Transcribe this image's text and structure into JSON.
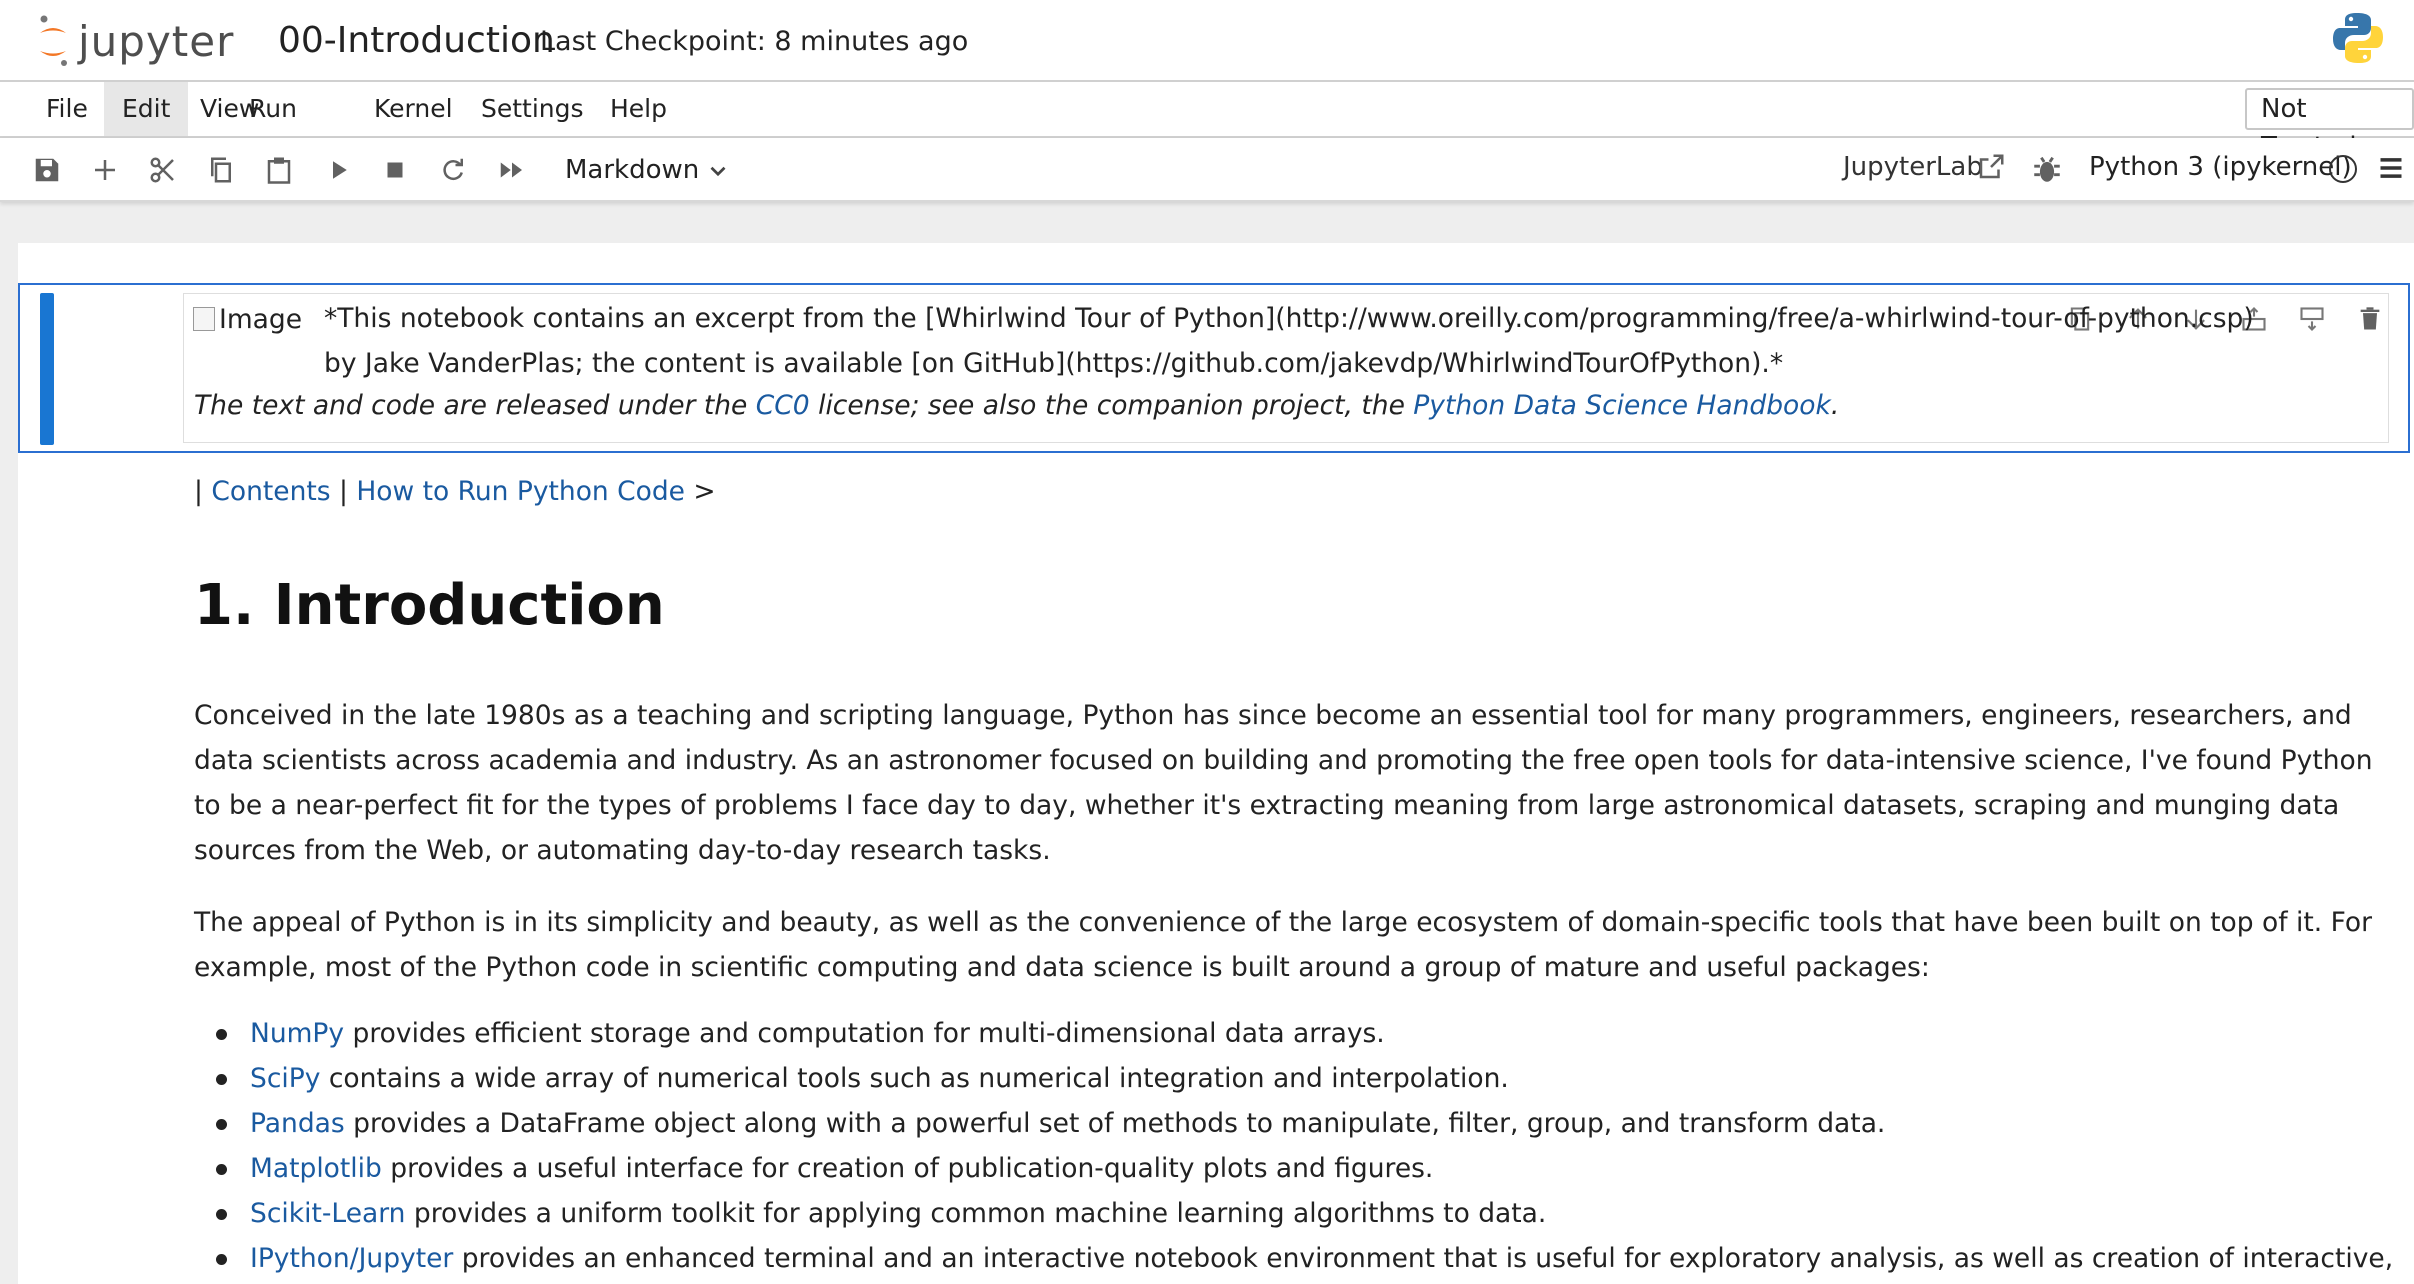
{
  "app": {
    "brand": "jupyter",
    "notebook_title": "00-Introduction",
    "checkpoint": "Last Checkpoint: 8 minutes ago",
    "accent_color": "#1976d2",
    "logo_orange": "#f37726"
  },
  "menu": {
    "items": [
      "File",
      "Edit",
      "View",
      "Run",
      "Kernel",
      "Settings",
      "Help"
    ],
    "active": "Edit",
    "trust_label": "Not Trusted"
  },
  "toolbar": {
    "buttons": [
      "save-icon",
      "add-cell-icon",
      "cut-icon",
      "copy-icon",
      "paste-icon",
      "run-icon",
      "stop-icon",
      "restart-icon",
      "run-all-icon"
    ],
    "cell_type": "Markdown",
    "jupyterlab_link": "JupyterLab",
    "kernel": "Python 3 (ipykernel)"
  },
  "cell": {
    "image_alt": "Image",
    "excerpt": "*This notebook contains an excerpt from the [Whirlwind Tour of Python](http://www.oreilly.com/programming/free/a-whirlwind-tour-of-python.csp) by Jake VanderPlas; the content is available [on GitHub](https://github.com/jakevdp/WhirlwindTourOfPython).*",
    "license_prefix": "The text and code are released under the ",
    "license_link": "CC0",
    "license_middle": " license; see also the companion project, the ",
    "handbook_link": "Python Data Science Handbook",
    "license_suffix": "."
  },
  "nav": {
    "sep1": "| ",
    "contents": "Contents",
    "sep2": " | ",
    "next": "How to Run Python Code",
    "arrow": " >"
  },
  "content": {
    "heading": "1. Introduction",
    "para1": "Conceived in the late 1980s as a teaching and scripting language, Python has since become an essential tool for many programmers, engineers, researchers, and data scientists across academia and industry. As an astronomer focused on building and promoting the free open tools for data-intensive science, I've found Python to be a near-perfect fit for the types of problems I face day to day, whether it's extracting meaning from large astronomical datasets, scraping and munging data sources from the Web, or automating day-to-day research tasks.",
    "para2": "The appeal of Python is in its simplicity and beauty, as well as the convenience of the large ecosystem of domain-specific tools that have been built on top of it. For example, most of the Python code in scientific computing and data science is built around a group of mature and useful packages:",
    "packages": [
      {
        "name": "NumPy",
        "desc": " provides efficient storage and computation for multi-dimensional data arrays."
      },
      {
        "name": "SciPy",
        "desc": " contains a wide array of numerical tools such as numerical integration and interpolation."
      },
      {
        "name": "Pandas",
        "desc": " provides a DataFrame object along with a powerful set of methods to manipulate, filter, group, and transform data."
      },
      {
        "name": "Matplotlib",
        "desc": " provides a useful interface for creation of publication-quality plots and figures."
      },
      {
        "name": "Scikit-Learn",
        "desc": " provides a uniform toolkit for applying common machine learning algorithms to data."
      },
      {
        "name": "IPython/Jupyter",
        "desc": " provides an enhanced terminal and an interactive notebook environment that is useful for exploratory analysis, as well as creation of interactive,"
      }
    ]
  }
}
